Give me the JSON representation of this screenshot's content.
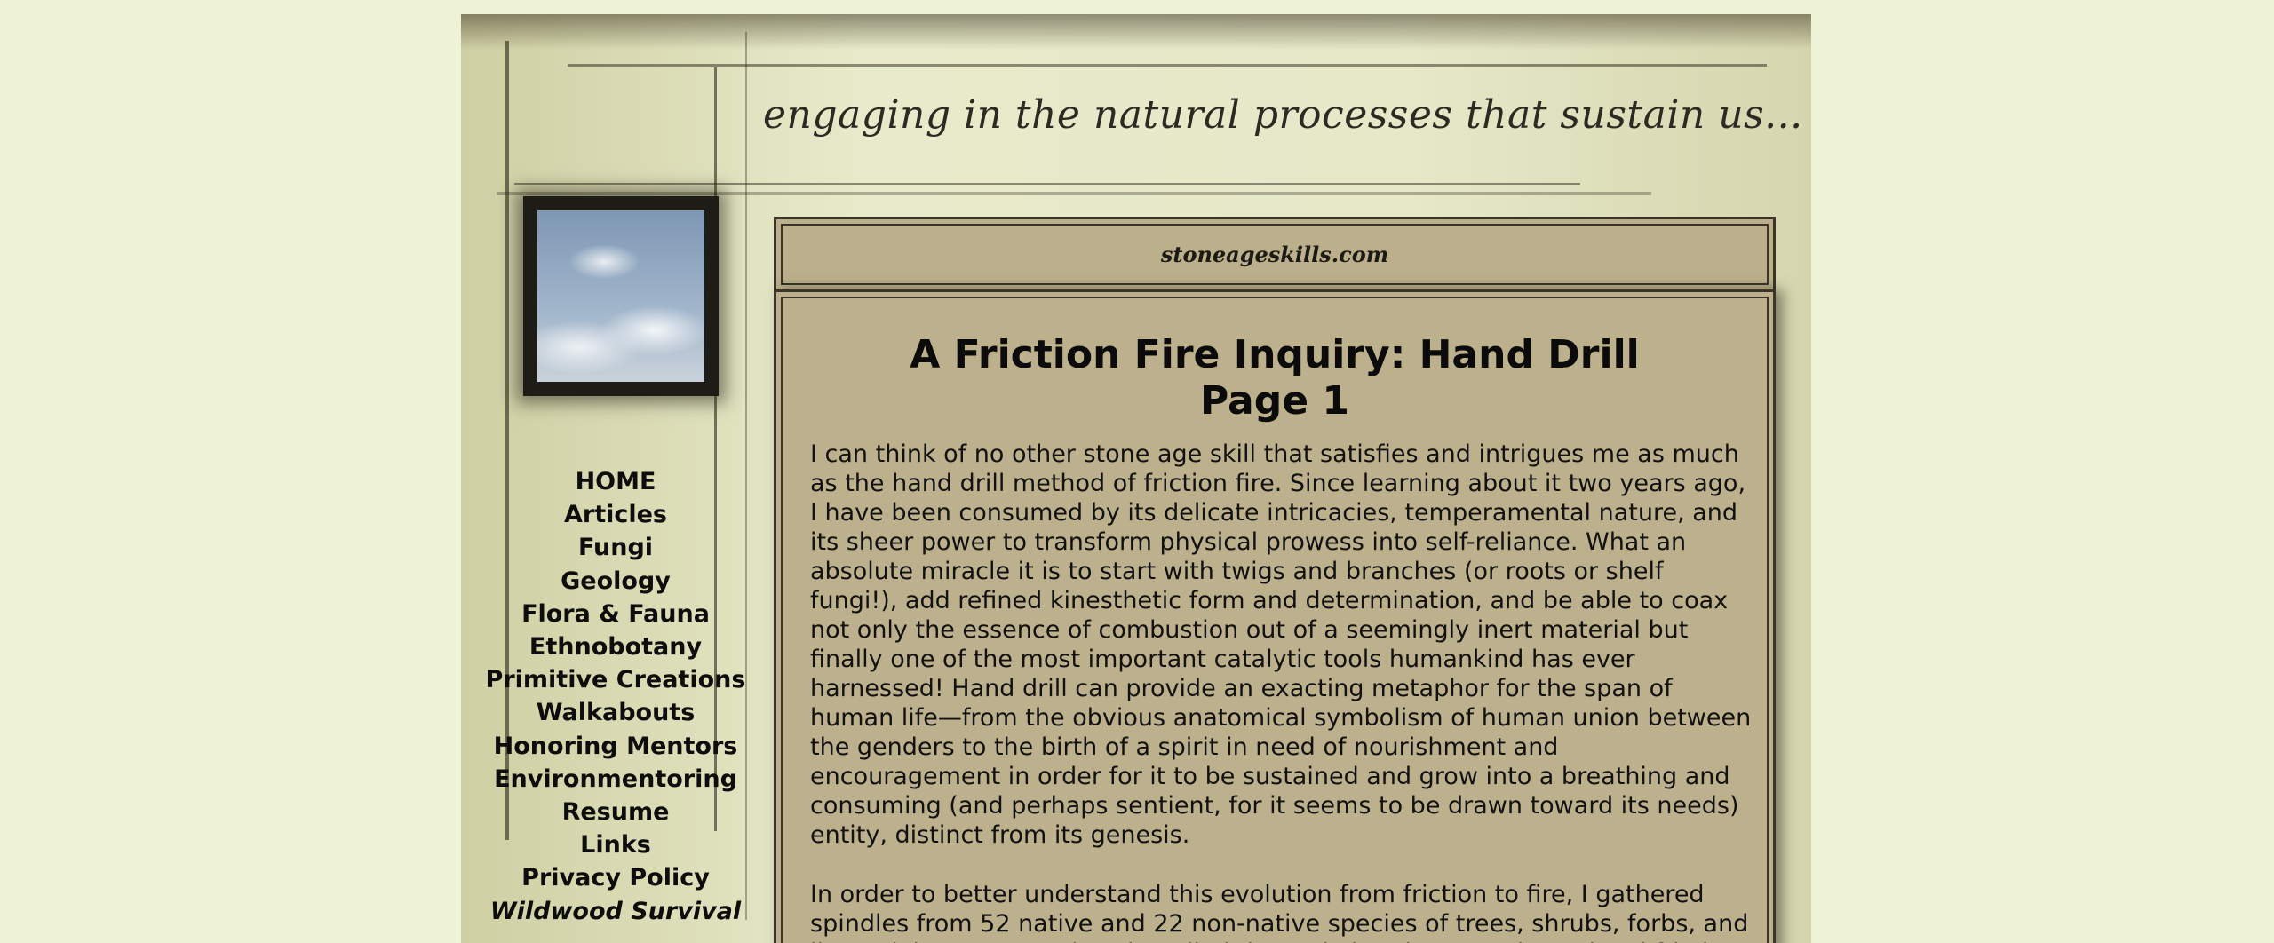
{
  "header": {
    "tagline": "engaging in the natural processes that sustain us...",
    "site_name": "stoneageskills.com"
  },
  "nav": {
    "items": [
      {
        "label": "HOME"
      },
      {
        "label": "Articles"
      },
      {
        "label": "Fungi"
      },
      {
        "label": "Geology"
      },
      {
        "label": "Flora & Fauna"
      },
      {
        "label": "Ethnobotany"
      },
      {
        "label": "Primitive Creations"
      },
      {
        "label": "Walkabouts"
      },
      {
        "label": "Honoring Mentors"
      },
      {
        "label": "Environmentoring"
      },
      {
        "label": "Resume"
      },
      {
        "label": "Links"
      },
      {
        "label": "Privacy Policy"
      },
      {
        "label": "Wildwood Survival"
      }
    ]
  },
  "article": {
    "title_line1": "A Friction Fire Inquiry: Hand Drill",
    "title_line2": "Page 1",
    "paragraph1": "I can think of no other stone age skill that satisfies and intrigues me as much as the hand drill method of friction fire. Since learning about it two years ago, I have been consumed by its delicate intricacies, temperamental nature, and its sheer power to transform physical prowess into self-reliance. What an absolute miracle it is to start with twigs and branches (or roots or shelf fungi!), add refined kinesthetic form and determination, and be able to coax not only the essence of combustion out of a seemingly inert material but finally one of the most important catalytic tools humankind has ever harnessed! Hand drill can provide an exacting metaphor for the span of human life—from the obvious anatomical symbolism of human union between the genders to the birth of a spirit in need of nourishment and encouragement in order for it to be sustained and grow into a breathing and consuming (and perhaps sentient, for it seems to be drawn toward its needs) entity, distinct from its genesis.",
    "paragraph2": "In order to better understand this evolution from friction to fire, I gathered spindles from 52 native and 22 non-native species of trees, shrubs, forbs, and lianas (plus one grass) and applied them via hand-powered rotational friction"
  },
  "colors": {
    "page_background": "#eef2d6",
    "panel_background": "#bdb08c",
    "panel_border": "#3a3528"
  }
}
